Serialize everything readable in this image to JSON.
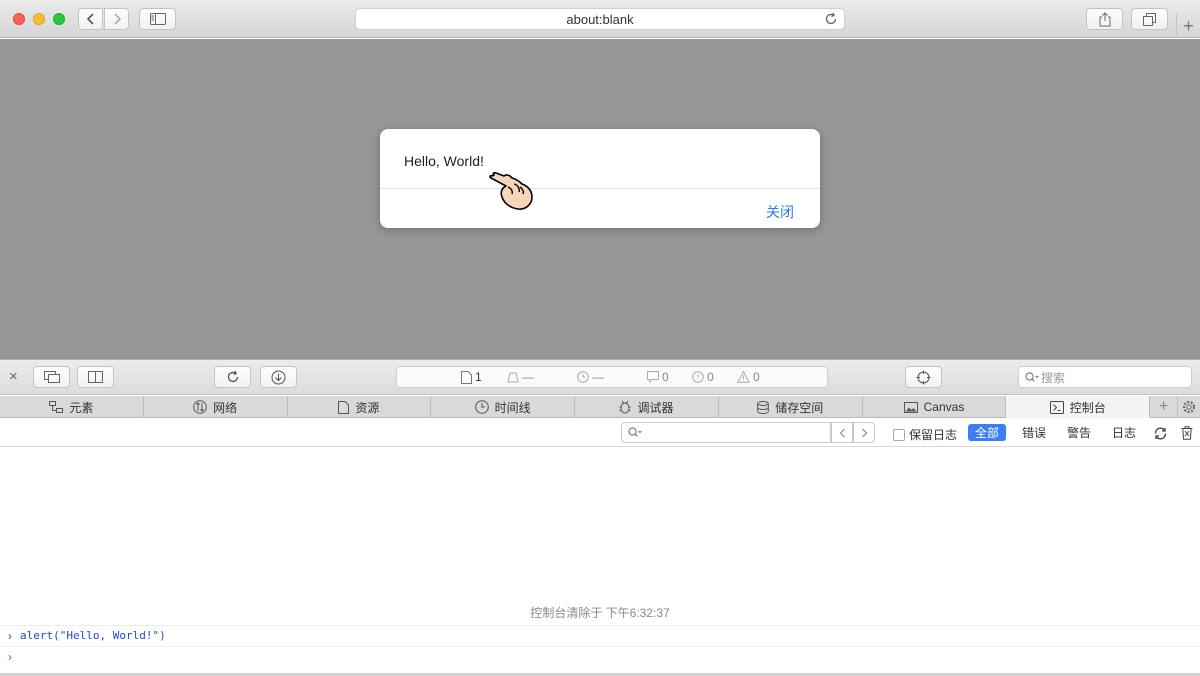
{
  "browser": {
    "url": "about:blank"
  },
  "dialog": {
    "message": "Hello, World!",
    "close_label": "关闭"
  },
  "inspector": {
    "activity": {
      "resources_count": "1",
      "bytes": "—",
      "time": "—",
      "logs": "0",
      "errors": "0",
      "warnings": "0"
    },
    "search_placeholder": "搜索",
    "tabs": [
      {
        "label": "元素",
        "icon": "elements-icon"
      },
      {
        "label": "网络",
        "icon": "network-icon"
      },
      {
        "label": "资源",
        "icon": "resources-icon"
      },
      {
        "label": "时间线",
        "icon": "timeline-icon"
      },
      {
        "label": "调试器",
        "icon": "debugger-icon"
      },
      {
        "label": "储存空间",
        "icon": "storage-icon"
      },
      {
        "label": "Canvas",
        "icon": "canvas-icon"
      },
      {
        "label": "控制台",
        "icon": "console-icon",
        "active": true
      }
    ],
    "filter": {
      "preserve_log": "保留日志",
      "levels": [
        "全部",
        "错误",
        "警告",
        "日志"
      ],
      "active_level": "全部"
    },
    "console": {
      "cleared_message": "控制台清除于 下午6:32:37",
      "entries": [
        "alert(\"Hello, World!\")"
      ]
    }
  },
  "colors": {
    "accent": "#3a7df5",
    "page_overlay": "#979797",
    "link": "#2f7bea"
  }
}
